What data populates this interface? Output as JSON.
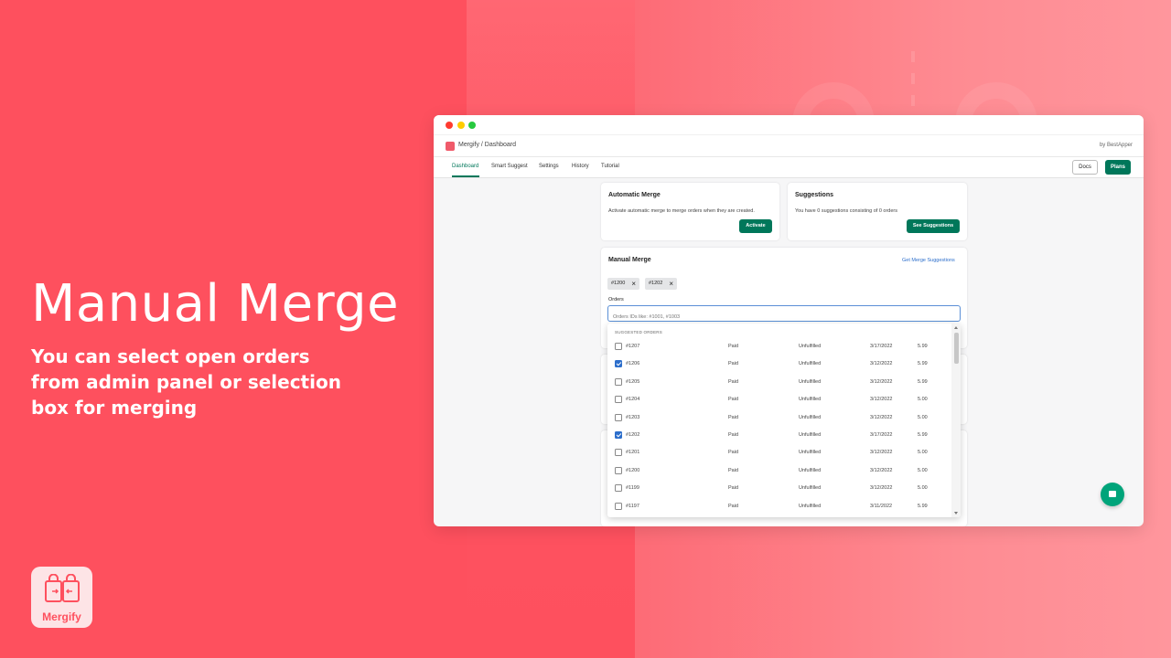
{
  "hero": {
    "title": "Manual Merge",
    "subtitle": "You can select open orders from admin panel or selection box for merging"
  },
  "logo": {
    "text": "Mergify"
  },
  "app": {
    "breadcrumb": "Mergify / Dashboard",
    "byline": "by BestApper",
    "tabs": [
      "Dashboard",
      "Smart Suggest",
      "Settings",
      "History",
      "Tutorial"
    ],
    "active_tab": "Dashboard",
    "docs_label": "Docs",
    "plans_label": "Plans"
  },
  "automatic_merge": {
    "title": "Automatic Merge",
    "text": "Activate automatic merge to merge orders when they are created.",
    "button": "Activate"
  },
  "suggestions": {
    "title": "Suggestions",
    "text": "You have 0 suggestions consisting of 0 orders",
    "button": "See Suggestions"
  },
  "manual_merge": {
    "title": "Manual Merge",
    "link": "Get Merge Suggestions",
    "tags": [
      "#1200",
      "#1202"
    ],
    "orders_label": "Orders",
    "placeholder": "Orders IDs like: #1001, #1003",
    "dropdown_header": "SUGGESTED ORDERS",
    "orders": [
      {
        "id": "#1207",
        "payment": "Paid",
        "fulfillment": "Unfulfilled",
        "date": "3/17/2022",
        "total": "5.99",
        "checked": false
      },
      {
        "id": "#1206",
        "payment": "Paid",
        "fulfillment": "Unfulfilled",
        "date": "3/12/2022",
        "total": "5.99",
        "checked": true
      },
      {
        "id": "#1205",
        "payment": "Paid",
        "fulfillment": "Unfulfilled",
        "date": "3/12/2022",
        "total": "5.99",
        "checked": false
      },
      {
        "id": "#1204",
        "payment": "Paid",
        "fulfillment": "Unfulfilled",
        "date": "3/12/2022",
        "total": "5.00",
        "checked": false
      },
      {
        "id": "#1203",
        "payment": "Paid",
        "fulfillment": "Unfulfilled",
        "date": "3/12/2022",
        "total": "5.00",
        "checked": false
      },
      {
        "id": "#1202",
        "payment": "Paid",
        "fulfillment": "Unfulfilled",
        "date": "3/17/2022",
        "total": "5.99",
        "checked": true
      },
      {
        "id": "#1201",
        "payment": "Paid",
        "fulfillment": "Unfulfilled",
        "date": "3/12/2022",
        "total": "5.00",
        "checked": false
      },
      {
        "id": "#1200",
        "payment": "Paid",
        "fulfillment": "Unfulfilled",
        "date": "3/12/2022",
        "total": "5.00",
        "checked": false
      },
      {
        "id": "#1199",
        "payment": "Paid",
        "fulfillment": "Unfulfilled",
        "date": "3/12/2022",
        "total": "5.00",
        "checked": false
      },
      {
        "id": "#1197",
        "payment": "Paid",
        "fulfillment": "Unfulfilled",
        "date": "3/11/2022",
        "total": "5.99",
        "checked": false
      }
    ]
  },
  "colors": {
    "background": "#fe505e",
    "primary": "#00775a",
    "checkbox": "#2c6ecb"
  }
}
